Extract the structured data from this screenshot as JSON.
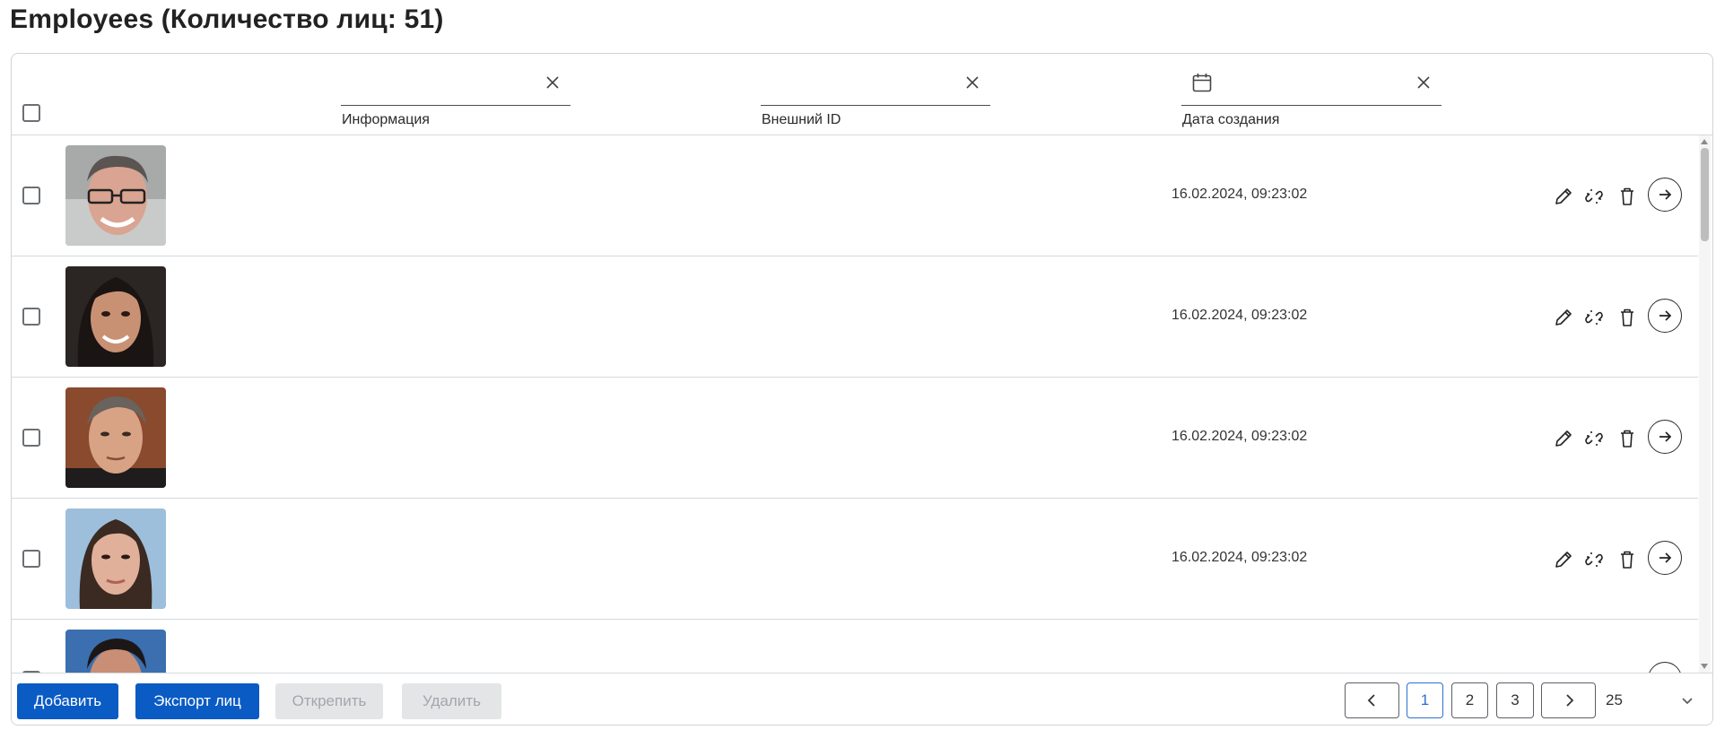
{
  "header": {
    "title": "Employees (Количество лиц: 51)"
  },
  "filters": [
    {
      "label": "Информация",
      "value": ""
    },
    {
      "label": "Внешний ID",
      "value": ""
    },
    {
      "label": "Дата создания",
      "value": ""
    }
  ],
  "rows": [
    {
      "photo": "face-man-glasses",
      "info": "",
      "external_id": "",
      "created": "16.02.2024, 09:23:02"
    },
    {
      "photo": "face-woman-dark-hair",
      "info": "",
      "external_id": "",
      "created": "16.02.2024, 09:23:02"
    },
    {
      "photo": "face-man-short-hair",
      "info": "",
      "external_id": "",
      "created": "16.02.2024, 09:23:02"
    },
    {
      "photo": "face-woman-long-hair",
      "info": "",
      "external_id": "",
      "created": "16.02.2024, 09:23:02"
    },
    {
      "photo": "face-man-dark-hair",
      "info": "",
      "external_id": "",
      "created": ""
    }
  ],
  "row_actions": {
    "edit_icon": "pencil-icon",
    "unlink_icon": "unlink-icon",
    "delete_icon": "trash-icon",
    "open_icon": "arrow-right-icon"
  },
  "footer": {
    "add_label": "Добавить",
    "export_label": "Экспорт лиц",
    "detach_label": "Открепить",
    "delete_label": "Удалить"
  },
  "pagination": {
    "pages": [
      "1",
      "2",
      "3"
    ],
    "current": "1",
    "page_size": "25"
  },
  "colors": {
    "primary": "#0a5bc4",
    "active_page": "#2d6fd0",
    "disabled_bg": "#e4e5e7",
    "border": "#cfd3d8"
  }
}
